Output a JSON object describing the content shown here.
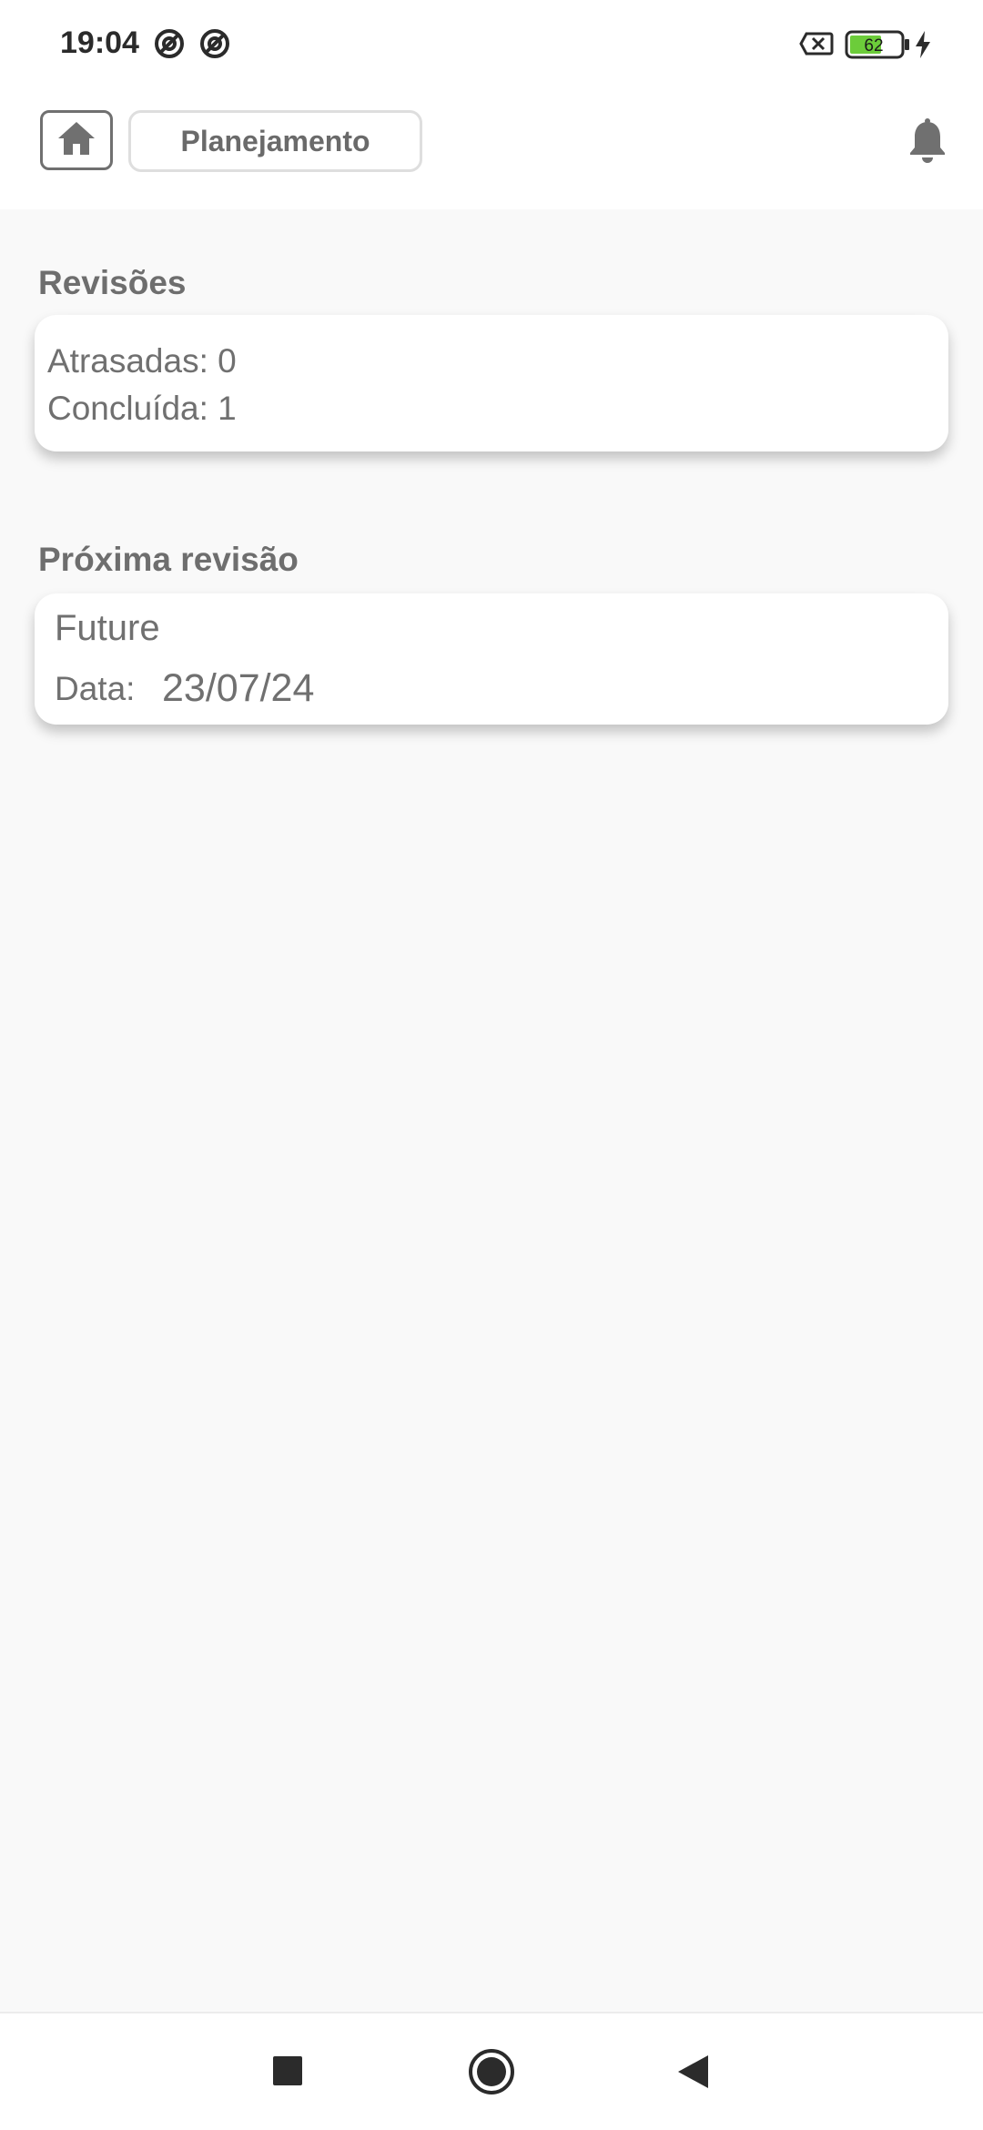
{
  "status_bar": {
    "time": "19:04",
    "battery_level": "62",
    "icons": [
      "at-sign-icon",
      "at-sign-icon",
      "no-sim-icon",
      "battery-icon",
      "charging-bolt-icon"
    ]
  },
  "header": {
    "home_icon": "home-icon",
    "tab_label": "Planejamento",
    "notification_icon": "bell-icon"
  },
  "reviews": {
    "title": "Revisões",
    "late": "Atrasadas: 0",
    "done": "Concluída: 1"
  },
  "next_review": {
    "title": "Próxima revisão",
    "name": "Future",
    "date_label": "Data:",
    "date_value": "23/07/24"
  },
  "nav_bar": {
    "icons": [
      "recents-square-icon",
      "home-circle-icon",
      "back-triangle-icon"
    ]
  },
  "colors": {
    "background": "#f9f9f9",
    "card": "#ffffff",
    "text": "#707070",
    "battery_fill": "#6ccc3a"
  }
}
